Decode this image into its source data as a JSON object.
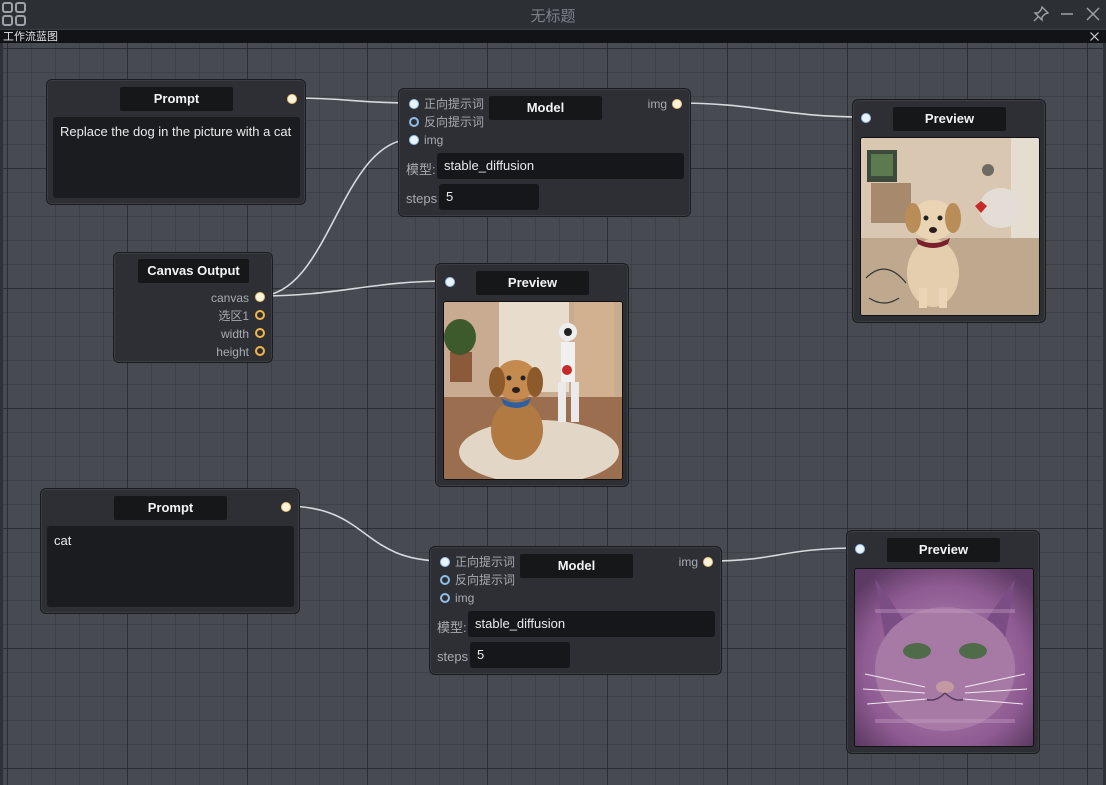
{
  "window": {
    "title": "无标题"
  },
  "tab": {
    "label": "工作流蓝图"
  },
  "nodes": {
    "prompt1": {
      "title": "Prompt",
      "text": "Replace the dog in the picture with a cat"
    },
    "prompt2": {
      "title": "Prompt",
      "text": "cat"
    },
    "canvas_output": {
      "title": "Canvas Output",
      "outputs": [
        "canvas",
        "选区1",
        "width",
        "height"
      ]
    },
    "model1": {
      "title": "Model",
      "inputs": [
        "正向提示词",
        "反向提示词",
        "img"
      ],
      "output": "img",
      "model_label": "模型:",
      "model_value": "stable_diffusion",
      "steps_label": "steps",
      "steps_value": "5"
    },
    "model2": {
      "title": "Model",
      "inputs": [
        "正向提示词",
        "反向提示词",
        "img"
      ],
      "output": "img",
      "model_label": "模型:",
      "model_value": "stable_diffusion",
      "steps_label": "steps",
      "steps_value": "5"
    },
    "preview1": {
      "title": "Preview"
    },
    "preview2": {
      "title": "Preview"
    },
    "preview3": {
      "title": "Preview"
    }
  },
  "colors": {
    "wire": "#d7d9dc",
    "output_port": "#f0b84b",
    "input_port": "#8fbfe6"
  },
  "icons": {
    "app": "grid-icon",
    "pin": "pin-icon",
    "minimize": "minimize-icon",
    "close": "close-icon"
  }
}
